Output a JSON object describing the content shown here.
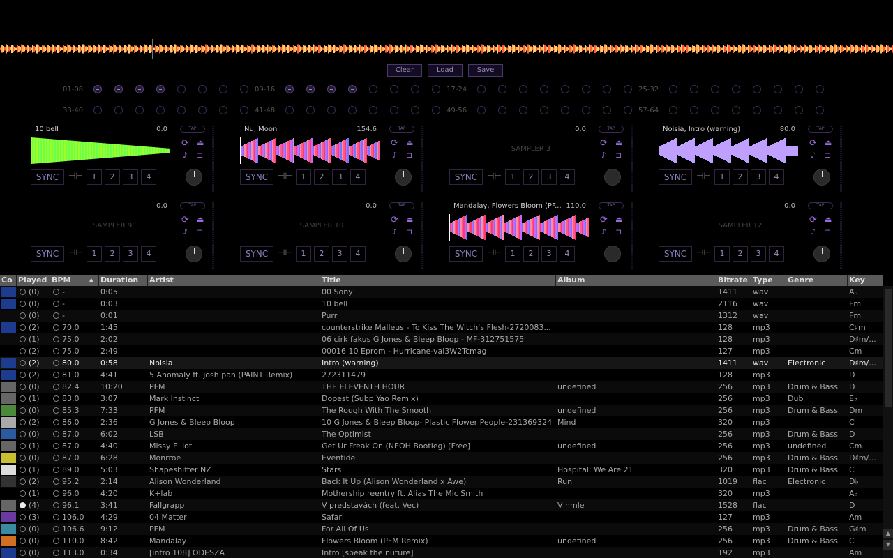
{
  "sampler_buttons": {
    "clear": "Clear",
    "load": "Load",
    "save": "Save"
  },
  "hotcue_groups": [
    {
      "label": "01-08",
      "set": [
        true,
        true,
        true,
        true,
        false,
        false,
        false,
        false
      ]
    },
    {
      "label": "09-16",
      "set": [
        true,
        true,
        true,
        true,
        false,
        false,
        false,
        false
      ]
    },
    {
      "label": "17-24",
      "set": [
        false,
        false,
        false,
        false,
        false,
        false,
        false,
        false
      ]
    },
    {
      "label": "25-32",
      "set": [
        false,
        false,
        false,
        false,
        false,
        false,
        false,
        false
      ]
    },
    {
      "label": "33-40",
      "set": [
        false,
        false,
        false,
        false,
        false,
        false,
        false,
        false
      ]
    },
    {
      "label": "41-48",
      "set": [
        false,
        false,
        false,
        false,
        false,
        false,
        false,
        false
      ]
    },
    {
      "label": "49-56",
      "set": [
        false,
        false,
        false,
        false,
        false,
        false,
        false,
        false
      ]
    },
    {
      "label": "57-64",
      "set": [
        false,
        false,
        false,
        false,
        false,
        false,
        false,
        false
      ]
    }
  ],
  "decks": [
    {
      "title": "10 bell",
      "bpm": "0.0",
      "sampler": "",
      "wave": "green"
    },
    {
      "title": "Nu, Moon",
      "bpm": "154.6",
      "sampler": "",
      "wave": "pink"
    },
    {
      "title": "",
      "bpm": "0.0",
      "sampler": "SAMPLER 3",
      "wave": ""
    },
    {
      "title": "Noisia, Intro (warning)",
      "bpm": "80.0",
      "sampler": "",
      "wave": "multi"
    },
    {
      "title": "",
      "bpm": "0.0",
      "sampler": "SAMPLER 9",
      "wave": ""
    },
    {
      "title": "",
      "bpm": "0.0",
      "sampler": "SAMPLER 10",
      "wave": ""
    },
    {
      "title": "Mandalay, Flowers Bloom (PF...",
      "bpm": "110.0",
      "sampler": "",
      "wave": "pink"
    },
    {
      "title": "",
      "bpm": "0.0",
      "sampler": "SAMPLER 12",
      "wave": ""
    }
  ],
  "deck_labels": {
    "tap": "TAP",
    "sync": "SYNC",
    "loops": [
      "1",
      "2",
      "3",
      "4"
    ]
  },
  "columns": [
    "Co",
    "Played",
    "BPM",
    "Duration",
    "Artist",
    "Title",
    "Album",
    "Bitrate",
    "Type",
    "Genre",
    "Key"
  ],
  "tracks": [
    {
      "cover": "bass",
      "played": "(0)",
      "bpm": "-",
      "duration": "0:05",
      "artist": "",
      "title": "00 Sony",
      "album": "",
      "bitrate": "1411",
      "type": "wav",
      "genre": "",
      "key": "A♭"
    },
    {
      "cover": "bass",
      "played": "(0)",
      "bpm": "-",
      "duration": "0:03",
      "artist": "",
      "title": "10 bell",
      "album": "",
      "bitrate": "2116",
      "type": "wav",
      "genre": "",
      "key": "Fm"
    },
    {
      "cover": "",
      "played": "(0)",
      "bpm": "-",
      "duration": "0:01",
      "artist": "",
      "title": "Purr",
      "album": "",
      "bitrate": "1312",
      "type": "wav",
      "genre": "",
      "key": "Fm"
    },
    {
      "cover": "bass",
      "played": "(2)",
      "bpm": "70.0",
      "duration": "1:45",
      "artist": "",
      "title": "counterstrike Malleus - To Kiss The Witch's Flesh-2720083...",
      "album": "",
      "bitrate": "128",
      "type": "mp3",
      "genre": "",
      "key": "C♯m"
    },
    {
      "cover": "",
      "played": "(1)",
      "bpm": "75.0",
      "duration": "2:02",
      "artist": "",
      "title": "06 cirk fakus G Jones & Bleep Bloop - MF-312751575",
      "album": "",
      "bitrate": "128",
      "type": "mp3",
      "genre": "",
      "key": "D♯m/..."
    },
    {
      "cover": "",
      "played": "(2)",
      "bpm": "75.0",
      "duration": "2:49",
      "artist": "",
      "title": "00016 10 Eprom - Hurricane-val3W2Tcmag",
      "album": "",
      "bitrate": "127",
      "type": "mp3",
      "genre": "",
      "key": "Cm"
    },
    {
      "cover": "bass",
      "played": "(2)",
      "bpm": "80.0",
      "duration": "0:58",
      "artist": "Noisia",
      "title": "Intro (warning)",
      "album": "",
      "bitrate": "1411",
      "type": "wav",
      "genre": "Electronic",
      "key": "D♯m/...",
      "sel": true
    },
    {
      "cover": "bass",
      "played": "(2)",
      "bpm": "81.0",
      "duration": "4:41",
      "artist": "5 Anomaly ft. josh pan (PAINT Remix)",
      "title": "272311479",
      "album": "",
      "bitrate": "128",
      "type": "mp3",
      "genre": "",
      "key": "D"
    },
    {
      "cover": "gray",
      "played": "(0)",
      "bpm": "82.4",
      "duration": "10:20",
      "artist": "PFM",
      "title": "THE ELEVENTH HOUR",
      "album": "undefined",
      "bitrate": "256",
      "type": "mp3",
      "genre": "Drum & Bass",
      "key": "D"
    },
    {
      "cover": "gray",
      "played": "(1)",
      "bpm": "83.0",
      "duration": "3:07",
      "artist": "Mark Instinct",
      "title": "Dopest (Subp Yao Remix)",
      "album": "",
      "bitrate": "256",
      "type": "mp3",
      "genre": "Dub",
      "key": "E♭"
    },
    {
      "cover": "green",
      "played": "(0)",
      "bpm": "85.3",
      "duration": "7:33",
      "artist": "PFM",
      "title": "The Rough With The Smooth",
      "album": "undefined",
      "bitrate": "256",
      "type": "mp3",
      "genre": "Drum & Bass",
      "key": "Dm"
    },
    {
      "cover": "eye",
      "played": "(2)",
      "bpm": "86.0",
      "duration": "2:36",
      "artist": "G Jones & Bleep Bloop",
      "title": "10 G Jones & Bleep Bloop- Plastic Flower People-231369324",
      "album": "Mind",
      "bitrate": "320",
      "type": "mp3",
      "genre": "",
      "key": "C"
    },
    {
      "cover": "blue",
      "played": "(0)",
      "bpm": "87.0",
      "duration": "6:02",
      "artist": "LSB",
      "title": "The Optimist",
      "album": "",
      "bitrate": "256",
      "type": "mp3",
      "genre": "Drum & Bass",
      "key": "D"
    },
    {
      "cover": "gray",
      "played": "(1)",
      "bpm": "87.0",
      "duration": "4:40",
      "artist": "Missy Elliot",
      "title": "Get Ur Freak On (NEOH Bootleg) [Free]",
      "album": "undefined",
      "bitrate": "256",
      "type": "mp3",
      "genre": "undefined",
      "key": "Cm"
    },
    {
      "cover": "yellow",
      "played": "(0)",
      "bpm": "87.0",
      "duration": "6:28",
      "artist": "Monrroe",
      "title": "Eventide",
      "album": "",
      "bitrate": "256",
      "type": "mp3",
      "genre": "Drum & Bass",
      "key": "D♯m/..."
    },
    {
      "cover": "white",
      "played": "(1)",
      "bpm": "89.0",
      "duration": "5:03",
      "artist": "Shapeshifter NZ",
      "title": "Stars",
      "album": "Hospital: We Are 21",
      "bitrate": "320",
      "type": "mp3",
      "genre": "Drum & Bass",
      "key": "C"
    },
    {
      "cover": "dark",
      "played": "(2)",
      "bpm": "95.2",
      "duration": "2:14",
      "artist": "Alison Wonderland",
      "title": "Back It Up (Alison Wonderland x Awe)",
      "album": "Run",
      "bitrate": "1019",
      "type": "flac",
      "genre": "Electronic",
      "key": "D♭"
    },
    {
      "cover": "",
      "played": "(1)",
      "bpm": "96.0",
      "duration": "4:20",
      "artist": "K+lab",
      "title": "Mothership reentry ft. Alias  The Mic Smith",
      "album": "",
      "bitrate": "320",
      "type": "mp3",
      "genre": "",
      "key": "A♭"
    },
    {
      "cover": "gray",
      "played": "(4)",
      "bpm": "96.1",
      "duration": "3:41",
      "artist": "Fallgrapp",
      "title": "V predstavách (feat. Vec)",
      "album": "V hmle",
      "bitrate": "1528",
      "type": "flac",
      "genre": "",
      "key": "D",
      "playedOn": true
    },
    {
      "cover": "purple",
      "played": "(3)",
      "bpm": "106.0",
      "duration": "4:29",
      "artist": "04 Matter",
      "title": "Safari",
      "album": "",
      "bitrate": "127",
      "type": "mp3",
      "genre": "",
      "key": "Am"
    },
    {
      "cover": "teal",
      "played": "(0)",
      "bpm": "106.6",
      "duration": "9:12",
      "artist": "PFM",
      "title": "For All Of Us",
      "album": "",
      "bitrate": "256",
      "type": "mp3",
      "genre": "Drum & Bass",
      "key": "G♯m"
    },
    {
      "cover": "orange",
      "played": "(0)",
      "bpm": "110.0",
      "duration": "8:42",
      "artist": "Mandalay",
      "title": "Flowers Bloom (PFM Remix)",
      "album": "undefined",
      "bitrate": "256",
      "type": "mp3",
      "genre": "Drum & Bass",
      "key": "C"
    },
    {
      "cover": "bass",
      "played": "(0)",
      "bpm": "113.0",
      "duration": "0:34",
      "artist": "[intro 108] ODESZA",
      "title": "Intro [speak the nuture]",
      "album": "",
      "bitrate": "192",
      "type": "mp3",
      "genre": "",
      "key": "Am"
    }
  ]
}
